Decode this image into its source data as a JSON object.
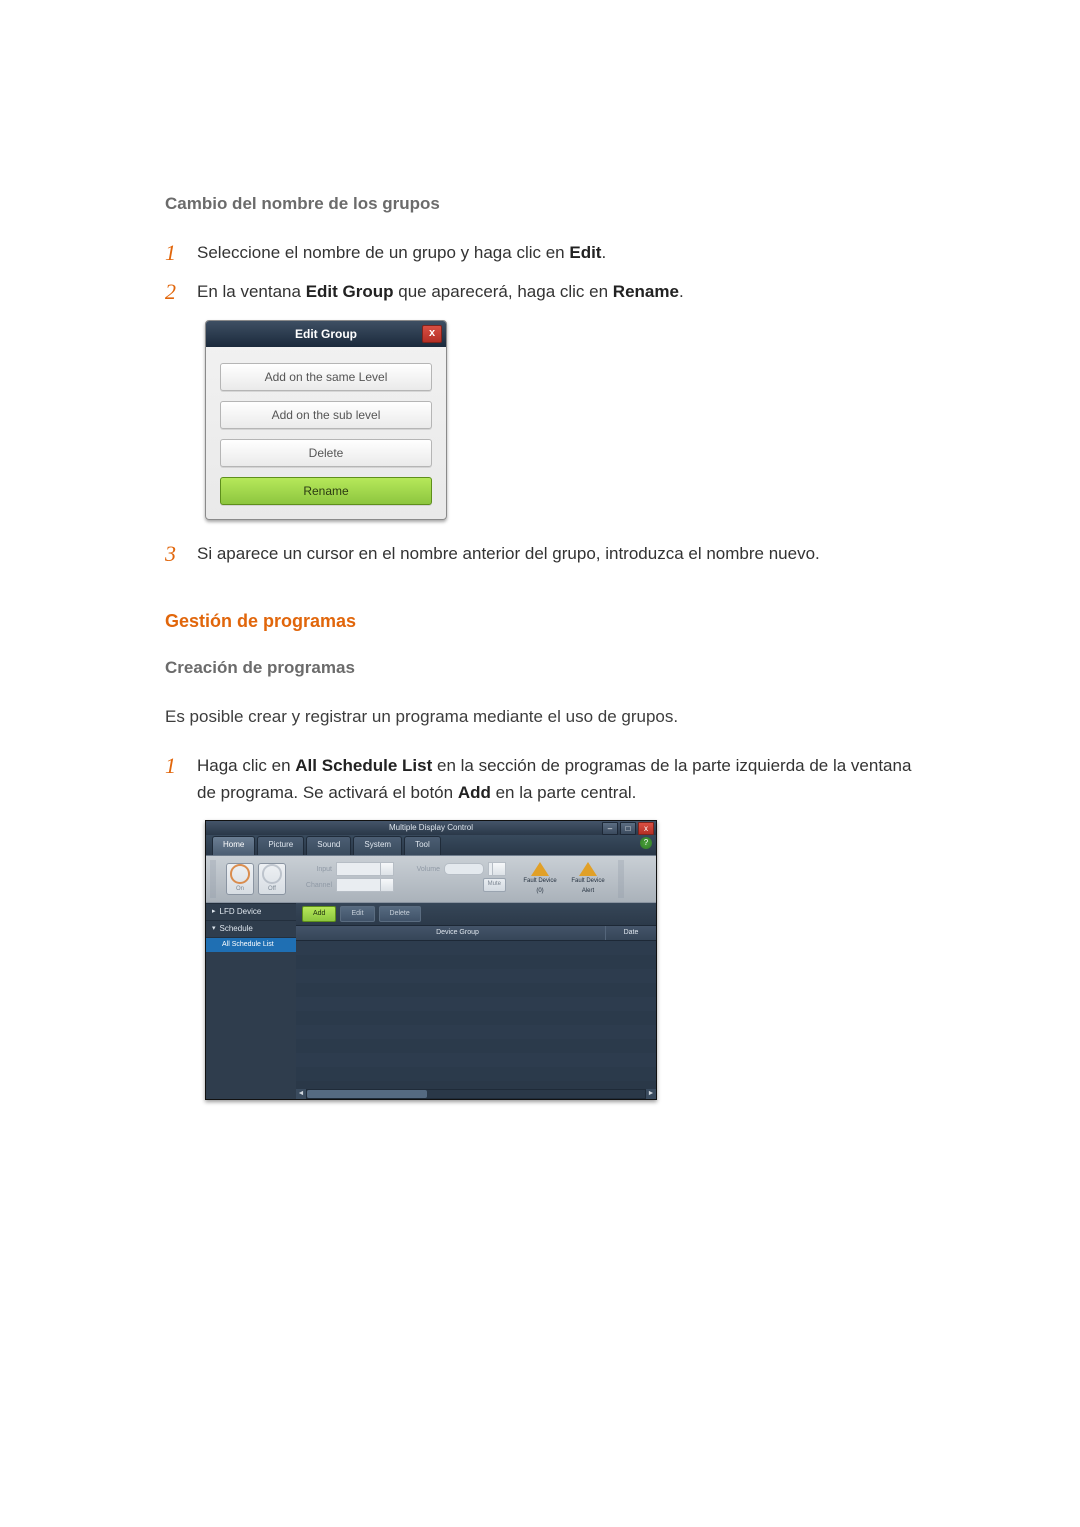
{
  "section1": {
    "title": "Cambio del nombre de los grupos",
    "steps": [
      {
        "num": "1",
        "pre": "Seleccione el nombre de un grupo y haga clic en ",
        "bold": "Edit",
        "post": "."
      },
      {
        "num": "2",
        "pre": "En la ventana ",
        "bold": "Edit Group",
        "mid": " que aparecerá, haga clic en ",
        "bold2": "Rename",
        "post": "."
      },
      {
        "num": "3",
        "pre": "Si aparece un cursor en el nombre anterior del grupo, introduzca el nombre nuevo.",
        "bold": "",
        "post": ""
      }
    ]
  },
  "dialog": {
    "title": "Edit Group",
    "close": "x",
    "buttons": [
      "Add on the same Level",
      "Add on the sub level",
      "Delete",
      "Rename"
    ]
  },
  "section2": {
    "title": "Gestión de programas",
    "subtitle": "Creación de programas",
    "intro": "Es posible crear y registrar un programa mediante el uso de grupos.",
    "stepnum": "1",
    "step_pre": "Haga clic en ",
    "step_b1": "All Schedule List",
    "step_mid": " en la sección de programas de la parte izquierda de la ventana de programa. Se activará el botón ",
    "step_b2": "Add",
    "step_post": " en la parte central."
  },
  "mdc": {
    "title": "Multiple Display Control",
    "winbtns": [
      "–",
      "□",
      "x"
    ],
    "tabs": [
      "Home",
      "Picture",
      "Sound",
      "System",
      "Tool"
    ],
    "help": "?",
    "power": {
      "on": "On",
      "off": "Off"
    },
    "inputLabel": "Input",
    "channelLabel": "Channel",
    "volumeLabel": "Volume",
    "muteLabel": "Mute",
    "alerts": [
      "Fault Device (0)",
      "Fault Device Alert"
    ],
    "side": {
      "lfd": "LFD Device",
      "schedule": "Schedule",
      "allSchedule": "All Schedule List"
    },
    "toolbar": {
      "add": "Add",
      "edit": "Edit",
      "delete": "Delete"
    },
    "columns": {
      "group": "Device Group",
      "date": "Date"
    }
  }
}
